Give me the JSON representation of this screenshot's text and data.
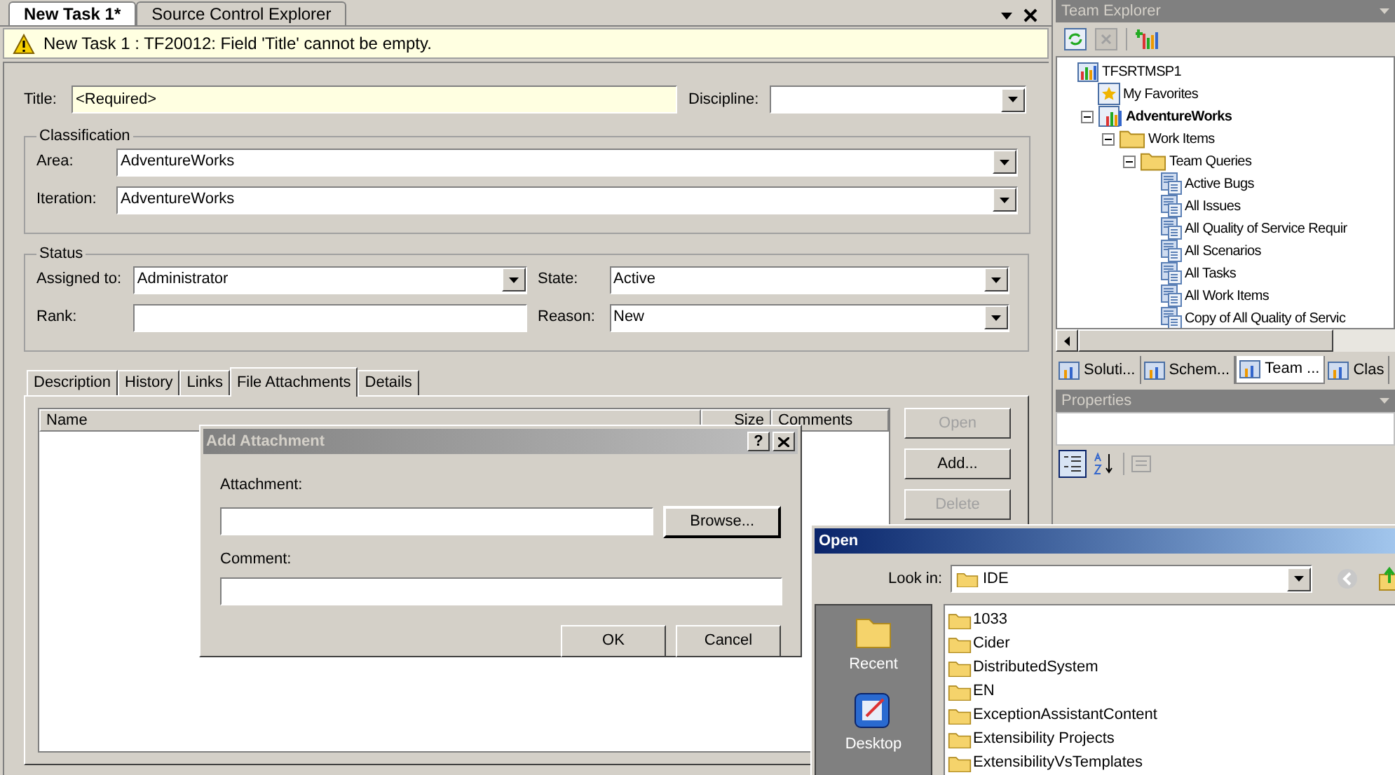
{
  "document_tabs": [
    {
      "label": "New Task 1*",
      "selected": true
    },
    {
      "label": "Source Control Explorer",
      "selected": false
    }
  ],
  "warning": "New Task 1 : TF20012: Field 'Title' cannot be empty.",
  "title_field": {
    "label": "Title:",
    "value": "<Required>",
    "required": true
  },
  "discipline": {
    "label": "Discipline:"
  },
  "classification": {
    "legend": "Classification",
    "fields": [
      {
        "label": "Area:",
        "value": "AdventureWorks"
      },
      {
        "label": "Iteration:",
        "value": "AdventureWorks"
      }
    ]
  },
  "status": {
    "legend": "Status",
    "fields": [
      {
        "label": "Assigned to:",
        "value": "Administrator",
        "kind": "dropdown"
      },
      {
        "label": "State:",
        "value": "Active",
        "kind": "dropdown"
      },
      {
        "label": "Rank:",
        "kind": "text"
      },
      {
        "label": "Reason:",
        "value": "New",
        "kind": "dropdown"
      }
    ]
  },
  "detail_tabs": [
    {
      "label": "Description",
      "selected": false
    },
    {
      "label": "History",
      "selected": false
    },
    {
      "label": "Links",
      "selected": false
    },
    {
      "label": "File Attachments",
      "selected": true
    },
    {
      "label": "Details",
      "selected": false
    }
  ],
  "attachments": {
    "columns": [
      "Name",
      "Size",
      "Comments"
    ],
    "buttons": [
      {
        "label": "Open",
        "disabled": true
      },
      {
        "label": "Add...",
        "disabled": false
      },
      {
        "label": "Delete",
        "disabled": true
      }
    ]
  },
  "add_attachment_dialog": {
    "title": "Add Attachment",
    "help": "?",
    "attachment_label": "Attachment:",
    "comment_label": "Comment:",
    "browse": "Browse...",
    "ok": "OK",
    "cancel": "Cancel"
  },
  "open_dialog": {
    "title": "Open",
    "look_in_label": "Look in:",
    "look_in_value": "IDE",
    "places": [
      "Recent",
      "Desktop"
    ],
    "items": [
      "1033",
      "Cider",
      "DistributedSystem",
      "EN",
      "ExceptionAssistantContent",
      "Extensibility Projects",
      "ExtensibilityVsTemplates"
    ]
  },
  "team_explorer": {
    "title": "Team Explorer",
    "tree": [
      {
        "label": "TFSRTMSP1",
        "kind": "server",
        "bold": false,
        "children": [
          {
            "label": "My Favorites",
            "kind": "favorites",
            "bold": false
          },
          {
            "label": "AdventureWorks",
            "kind": "project",
            "bold": true,
            "expanded": true,
            "children": [
              {
                "label": "Work Items",
                "kind": "folder",
                "bold": false,
                "expanded": true,
                "children": [
                  {
                    "label": "Team Queries",
                    "kind": "folder",
                    "bold": false,
                    "expanded": true,
                    "children": [
                      {
                        "label": "Active Bugs",
                        "kind": "query",
                        "bold": false
                      },
                      {
                        "label": "All Issues",
                        "kind": "query",
                        "bold": false
                      },
                      {
                        "label": "All Quality of Service Requir",
                        "kind": "query",
                        "bold": false
                      },
                      {
                        "label": "All Scenarios",
                        "kind": "query",
                        "bold": false
                      },
                      {
                        "label": "All Tasks",
                        "kind": "query",
                        "bold": false
                      },
                      {
                        "label": "All Work Items",
                        "kind": "query",
                        "bold": false
                      },
                      {
                        "label": "Copy of All Quality of Servic",
                        "kind": "query",
                        "bold": false
                      }
                    ]
                  }
                ]
              }
            ]
          }
        ]
      }
    ]
  },
  "panel_tabs": [
    {
      "label": "Soluti...",
      "selected": false
    },
    {
      "label": "Schem...",
      "selected": false
    },
    {
      "label": "Team ...",
      "selected": true
    },
    {
      "label": "Clas",
      "selected": false
    }
  ],
  "properties": {
    "title": "Properties"
  }
}
